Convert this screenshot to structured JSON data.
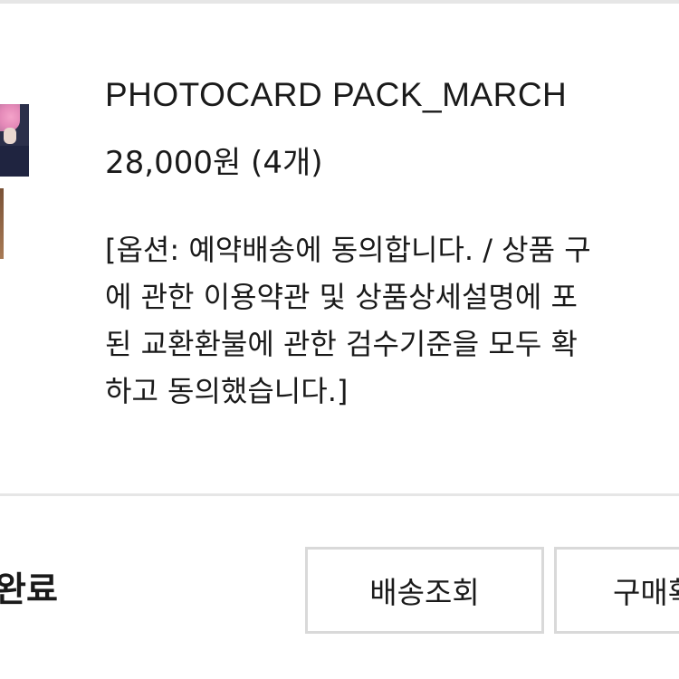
{
  "order": {
    "product_name": "PHOTOCARD PACK_MARCH",
    "price_line": "28,000원 (4개)",
    "option_lines": [
      "[옵션: 예약배송에 동의합니다. / 상품 구",
      "에 관한 이용약관 및 상품상세설명에 포",
      "된 교환환불에 관한 검수기준을 모두 확",
      "하고 동의했습니다.]"
    ],
    "status": "완료"
  },
  "actions": {
    "track_label": "배송조회",
    "confirm_label": "구매확정"
  },
  "colors": {
    "text": "#1a1a1a",
    "divider": "#e6e6e6",
    "button_border": "#d9d9d9",
    "thumbnail_hair": "#f4a3c9"
  }
}
